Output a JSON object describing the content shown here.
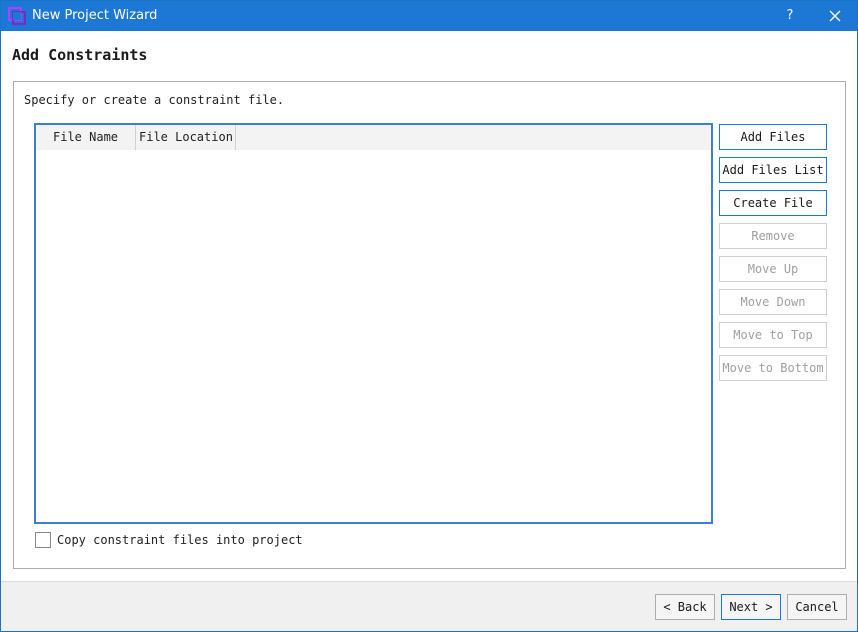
{
  "window": {
    "title": "New Project Wizard",
    "help_label": "?",
    "icons": {
      "app": "vivado-logo-icon",
      "close": "close-icon"
    }
  },
  "page": {
    "title": "Add Constraints",
    "description": "Specify or create a constraint file."
  },
  "table": {
    "columns": [
      "File Name",
      "File Location"
    ],
    "rows": []
  },
  "side_buttons": [
    {
      "label": "Add Files",
      "enabled": true
    },
    {
      "label": "Add Files List",
      "enabled": true
    },
    {
      "label": "Create File",
      "enabled": true
    },
    {
      "label": "Remove",
      "enabled": false
    },
    {
      "label": "Move Up",
      "enabled": false
    },
    {
      "label": "Move Down",
      "enabled": false
    },
    {
      "label": "Move to Top",
      "enabled": false
    },
    {
      "label": "Move to Bottom",
      "enabled": false
    }
  ],
  "copy_option": {
    "label": "Copy constraint files into project",
    "checked": false
  },
  "footer": {
    "back": "< Back",
    "next": "Next >",
    "cancel": "Cancel"
  },
  "colors": {
    "titlebar": "#1c78d4",
    "accent_border": "#3b7fcf",
    "disabled_text": "#a0a0a0"
  }
}
